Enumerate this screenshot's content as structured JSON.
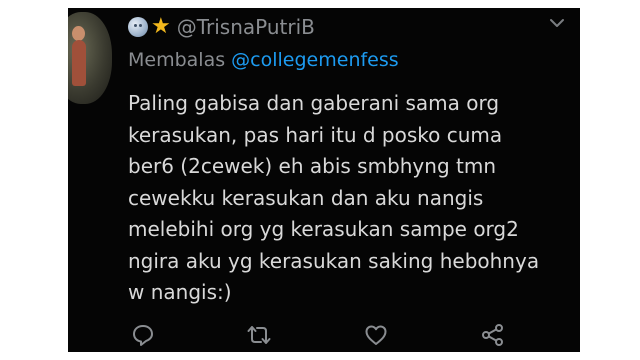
{
  "tweet": {
    "display_name_emoji": [
      "moon-face",
      "star"
    ],
    "username": "@TrisnaPutriB",
    "reply_prefix": "Membalas",
    "reply_handle": "@collegemenfess",
    "text_lines": [
      "Paling gabisa dan gaberani sama org",
      "kerasukan, pas hari itu d posko cuma",
      "ber6 (2cewek) eh abis smbhyng tmn",
      "cewekku kerasukan dan aku nangis",
      "melebihi org yg kerasukan sampe org2",
      "ngira aku yg kerasukan saking hebohnya",
      "w nangis:)"
    ]
  },
  "actions": [
    "reply-icon",
    "retweet-icon",
    "like-icon",
    "share-icon"
  ],
  "colors": {
    "background": "#050505",
    "text": "#d9d9d9",
    "muted": "#8a8d91",
    "link": "#1d9bf0",
    "outer": "#ffffff"
  }
}
